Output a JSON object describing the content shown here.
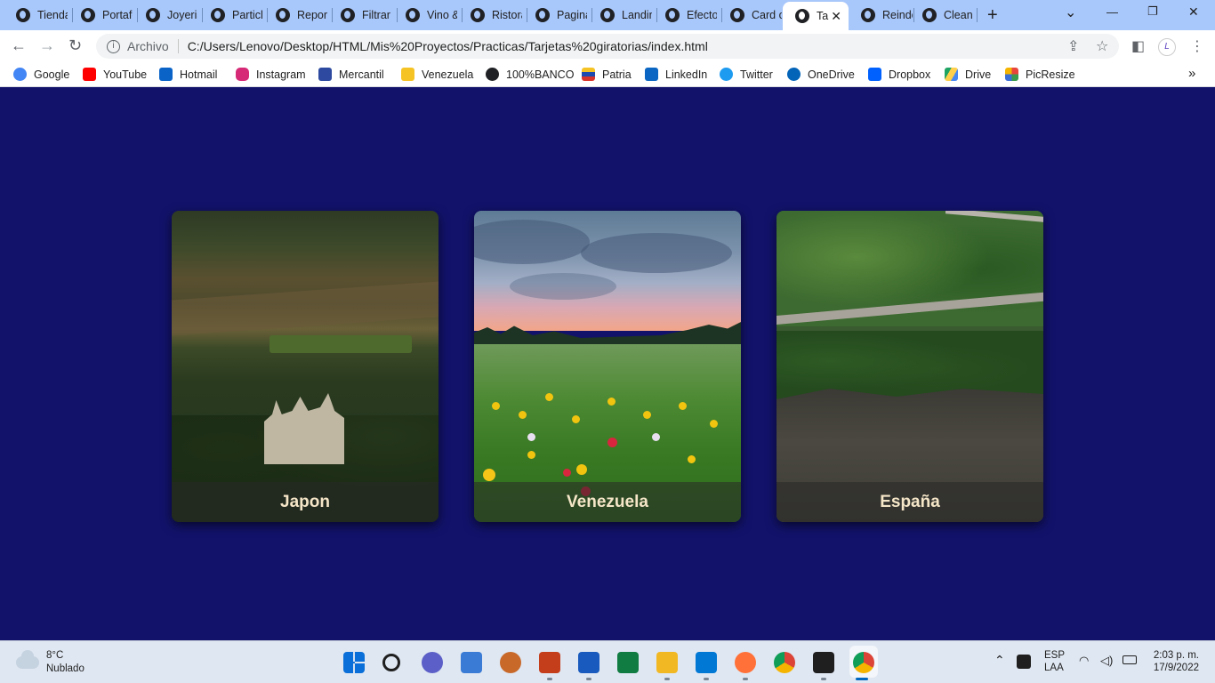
{
  "browser": {
    "tabs": [
      {
        "label": "Tienda",
        "active": false
      },
      {
        "label": "Portafolio",
        "active": false
      },
      {
        "label": "Joyeria",
        "active": false
      },
      {
        "label": "Particles",
        "active": false
      },
      {
        "label": "Reporte",
        "active": false
      },
      {
        "label": "Filtrar",
        "active": false
      },
      {
        "label": "Vino &",
        "active": false
      },
      {
        "label": "Ristorante",
        "active": false
      },
      {
        "label": "Pagina",
        "active": false
      },
      {
        "label": "Landing",
        "active": false
      },
      {
        "label": "Efecto",
        "active": false
      },
      {
        "label": "Card c",
        "active": false
      },
      {
        "label": "Ta",
        "active": true
      },
      {
        "label": "Reindeer",
        "active": false
      },
      {
        "label": "Clean",
        "active": false
      }
    ],
    "new_tab_symbol": "+",
    "window_controls": {
      "tab_search": "⌄",
      "minimize": "—",
      "restore": "❐",
      "close": "✕"
    },
    "address_bar": {
      "chip": "Archivo",
      "url": "C:/Users/Lenovo/Desktop/HTML/Mis%20Proyectos/Practicas/Tarjetas%20giratorias/index.html"
    },
    "bookmarks": [
      {
        "label": "Google",
        "color": "#4285f4"
      },
      {
        "label": "YouTube",
        "color": "#ff0000"
      },
      {
        "label": "Hotmail",
        "color": "#0a64c8"
      },
      {
        "label": "Instagram",
        "color": "#d62976"
      },
      {
        "label": "Mercantil",
        "color": "#2d4aa0"
      },
      {
        "label": "Venezuela",
        "color": "#f6c325"
      },
      {
        "label": "100%BANCO",
        "color": "#202124"
      },
      {
        "label": "Patria",
        "color": "#d9342b"
      },
      {
        "label": "LinkedIn",
        "color": "#0a66c2"
      },
      {
        "label": "Twitter",
        "color": "#1d9bf0"
      },
      {
        "label": "OneDrive",
        "color": "#0364b8"
      },
      {
        "label": "Dropbox",
        "color": "#0061fe"
      },
      {
        "label": "Drive",
        "color": "#1fa463"
      },
      {
        "label": "PicResize",
        "color": "#e8453c"
      }
    ],
    "bookmarks_overflow": "»"
  },
  "page": {
    "cards": [
      {
        "title": "Japon"
      },
      {
        "title": "Venezuela"
      },
      {
        "title": "España"
      }
    ]
  },
  "taskbar": {
    "weather": {
      "temp": "8°C",
      "condition": "Nublado"
    },
    "apps": [
      {
        "name": "start",
        "color": "#0a6fd8"
      },
      {
        "name": "search",
        "color": "#1f1f1f"
      },
      {
        "name": "teams",
        "color": "#5b5fc7"
      },
      {
        "name": "photos",
        "color": "#3a7bd5"
      },
      {
        "name": "baseball",
        "color": "#c8692a"
      },
      {
        "name": "powerpoint",
        "color": "#c43e1c"
      },
      {
        "name": "word",
        "color": "#185abd"
      },
      {
        "name": "excel",
        "color": "#107c41"
      },
      {
        "name": "explorer",
        "color": "#f2b824"
      },
      {
        "name": "vscode",
        "color": "#0078d4"
      },
      {
        "name": "firefox",
        "color": "#ff7139"
      },
      {
        "name": "chrome",
        "color": "#34a853"
      },
      {
        "name": "terminal",
        "color": "#1f1f1f"
      },
      {
        "name": "chrome-profile",
        "color": "#db4437"
      }
    ],
    "tray": {
      "lang_top": "ESP",
      "lang_bottom": "LAA",
      "time": "2:03 p. m.",
      "date": "17/9/2022"
    }
  }
}
